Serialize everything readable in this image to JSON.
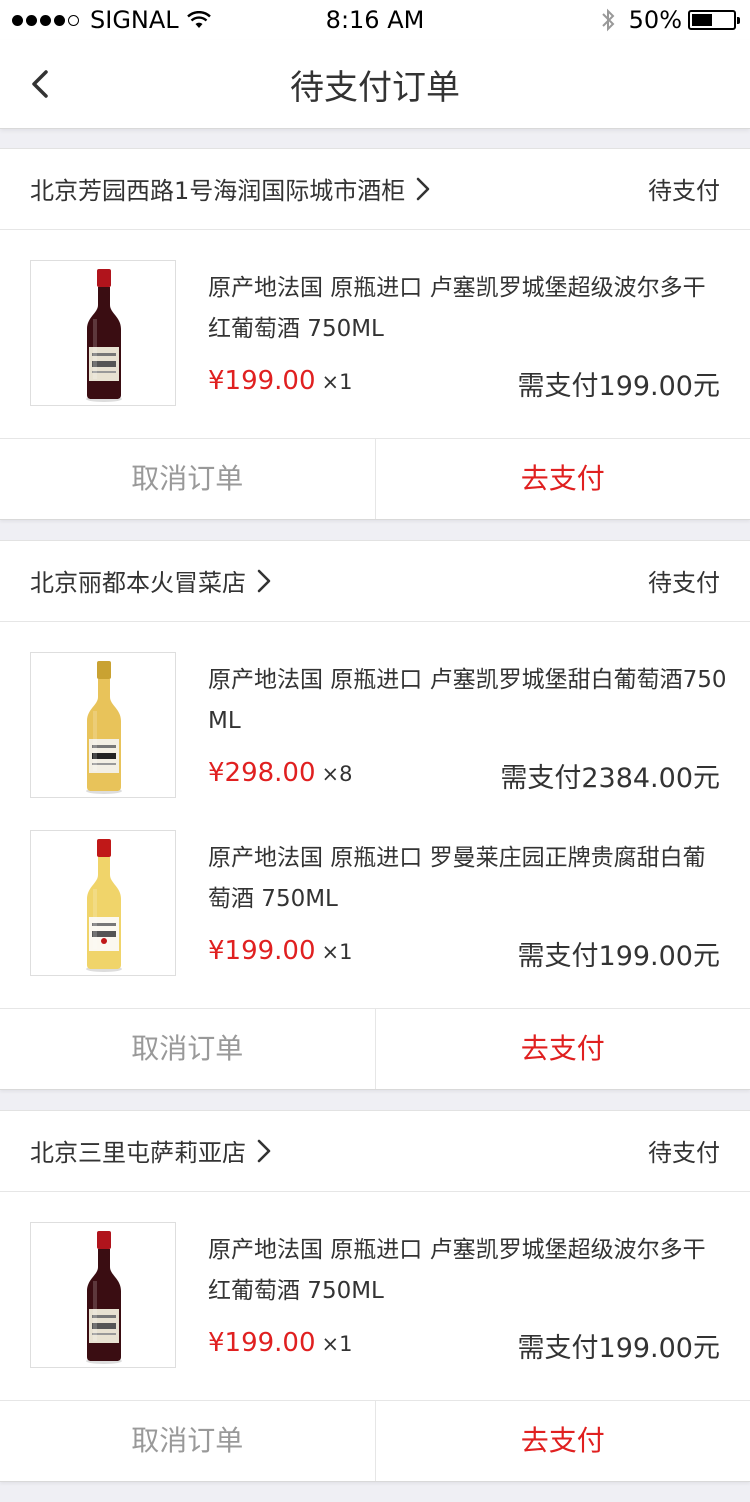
{
  "status_bar": {
    "carrier": "SIGNAL",
    "time": "8:16 AM",
    "battery": "50%",
    "battery_level": 0.5
  },
  "header": {
    "title": "待支付订单"
  },
  "orders": [
    {
      "store": "北京芳园西路1号海润国际城市酒柜",
      "status": "待支付",
      "items": [
        {
          "title": "原产地法国  原瓶进口  卢塞凯罗城堡超级波尔多干红葡萄酒   750ML",
          "price": "¥199.00",
          "qty": "×1",
          "need_pay": "需支付199.00元",
          "bottle": "red"
        }
      ],
      "cancel_label": "取消订单",
      "pay_label": "去支付"
    },
    {
      "store": "北京丽都本火冒菜店",
      "status": "待支付",
      "items": [
        {
          "title": "原产地法国  原瓶进口  卢塞凯罗城堡甜白葡萄酒750ML",
          "price": "¥298.00",
          "qty": "×8",
          "need_pay": "需支付2384.00元",
          "bottle": "white"
        },
        {
          "title": "原产地法国  原瓶进口  罗曼莱庄园正牌贵腐甜白葡萄酒   750ML",
          "price": "¥199.00",
          "qty": "×1",
          "need_pay": "需支付199.00元",
          "bottle": "white2"
        }
      ],
      "cancel_label": "取消订单",
      "pay_label": "去支付"
    },
    {
      "store": "北京三里屯萨莉亚店",
      "status": "待支付",
      "items": [
        {
          "title": "原产地法国  原瓶进口  卢塞凯罗城堡超级波尔多干红葡萄酒   750ML",
          "price": "¥199.00",
          "qty": "×1",
          "need_pay": "需支付199.00元",
          "bottle": "red"
        }
      ],
      "cancel_label": "取消订单",
      "pay_label": "去支付"
    }
  ],
  "colors": {
    "accent": "#e02020",
    "background": "#efeff4",
    "muted_text": "#999999"
  }
}
